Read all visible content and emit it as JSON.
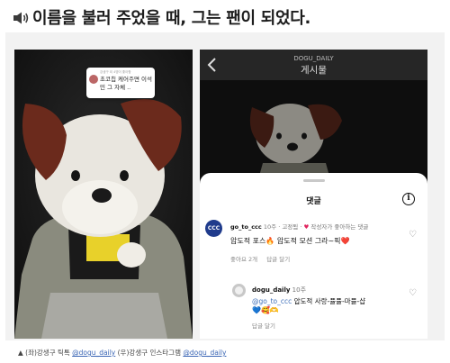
{
  "headline": {
    "icon": "speaker-icon",
    "text": "이름을 불러 주었을 때, 그는 팬이 되었다."
  },
  "left_image": {
    "tooltip": {
      "meta": "강생구 외 4명이 좋아함",
      "text": "초코칩 케어주면 이석민 그 자체 .."
    }
  },
  "right_image": {
    "header": {
      "username": "DOGU_DAILY",
      "title": "게시물",
      "back_icon": "chevron-left-icon"
    },
    "sheet": {
      "title": "댓글",
      "info_icon": "info-icon",
      "comments": [
        {
          "avatar_text": "CCC",
          "username": "go_to_ccc",
          "time": "10주",
          "pinned": "· 고정됨 ·",
          "liked_by_author": "작성자가 좋아하는 댓글",
          "text": "압도적 포스🔥 압도적 모션 그라~픽❤️",
          "likes": "좋아요 2개",
          "reply_label": "답글 달기"
        }
      ],
      "reply": {
        "username": "dogu_daily",
        "time": "10주",
        "mention": "@go_to_ccc",
        "text_rest": " 압도적 사랑-퓰퓰-마퓰-샵",
        "emojis": "💙🥰🫶",
        "reply_label": "답글 달기"
      }
    }
  },
  "caption": {
    "prefix": "▲ (좌)강생구 틱톡 ",
    "left_link": "@dogu_daily",
    "middle": " (우)강생구 인스타그램 ",
    "right_link": "@dogu_daily"
  },
  "colors": {
    "mention": "#3e6fb9",
    "heart": "#e0245e",
    "avatar_ccc": "#1f3b8c"
  }
}
